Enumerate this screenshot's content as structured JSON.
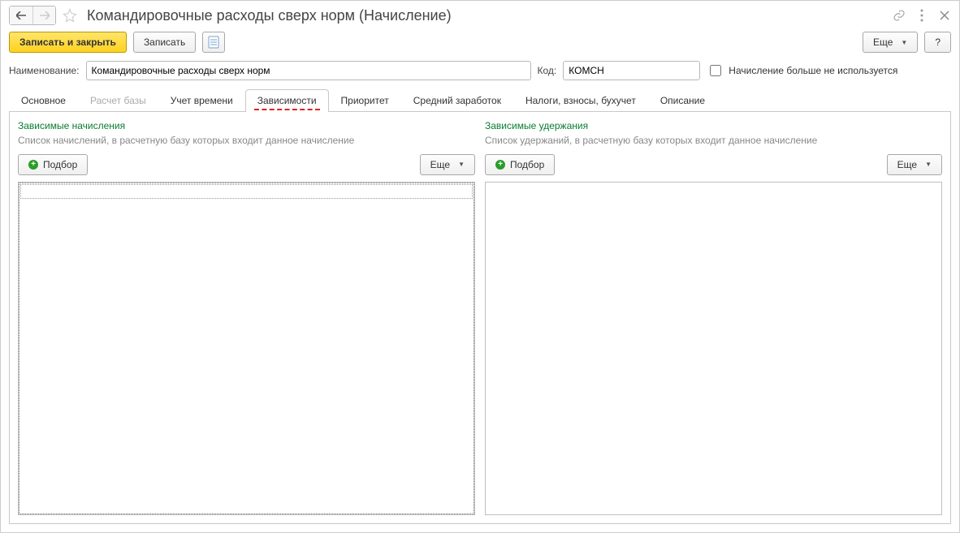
{
  "title": "Командировочные расходы сверх норм (Начисление)",
  "toolbar": {
    "saveClose": "Записать и закрыть",
    "save": "Записать",
    "more": "Еще",
    "help": "?"
  },
  "form": {
    "nameLabel": "Наименование:",
    "nameValue": "Командировочные расходы сверх норм",
    "codeLabel": "Код:",
    "codeValue": "КОМСН",
    "inactiveLabel": "Начисление больше не используется"
  },
  "tabs": [
    {
      "label": "Основное"
    },
    {
      "label": "Расчет базы",
      "disabled": true
    },
    {
      "label": "Учет времени"
    },
    {
      "label": "Зависимости",
      "active": true
    },
    {
      "label": "Приоритет"
    },
    {
      "label": "Средний заработок"
    },
    {
      "label": "Налоги, взносы, бухучет"
    },
    {
      "label": "Описание"
    }
  ],
  "deps": {
    "left": {
      "title": "Зависимые начисления",
      "desc": "Список начислений, в расчетную базу которых входит данное начисление",
      "pick": "Подбор",
      "more": "Еще"
    },
    "right": {
      "title": "Зависимые удержания",
      "desc": "Список удержаний, в расчетную базу которых входит данное начисление",
      "pick": "Подбор",
      "more": "Еще"
    }
  }
}
